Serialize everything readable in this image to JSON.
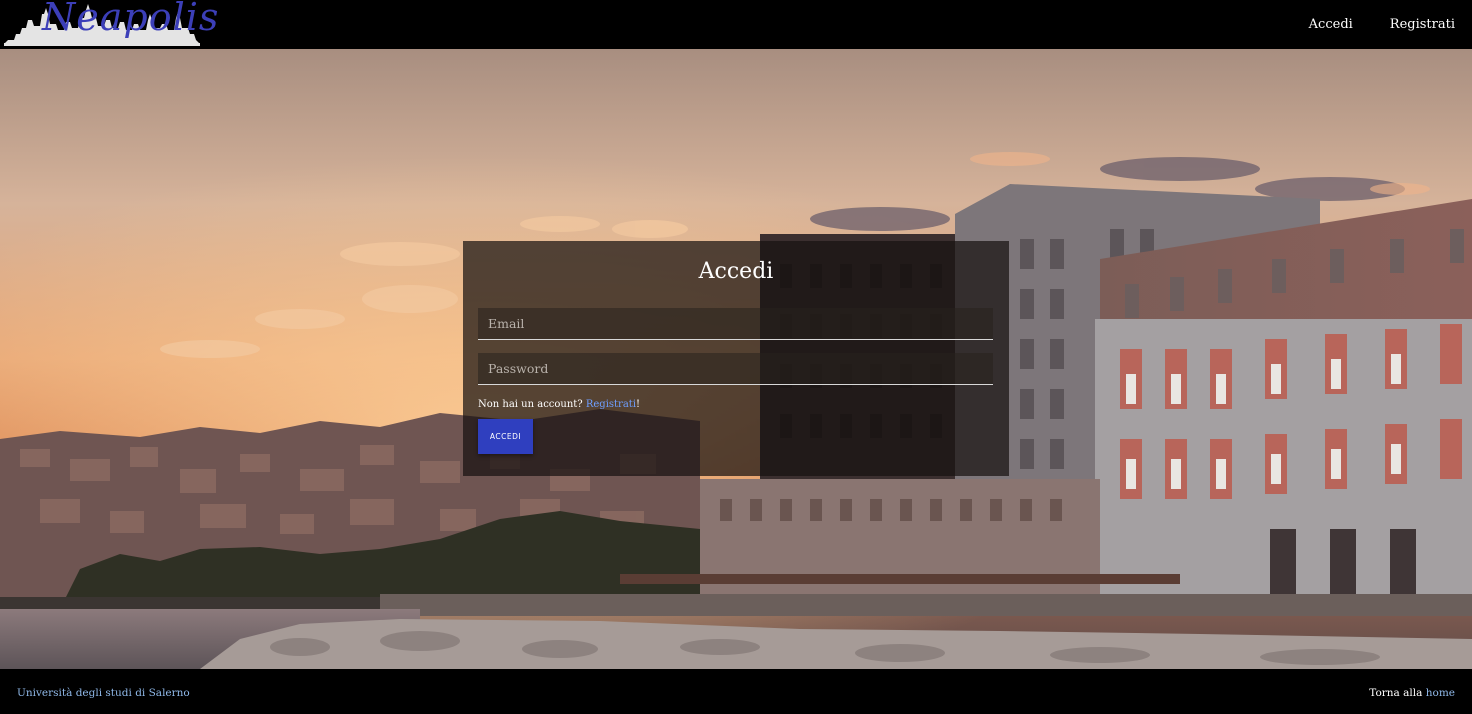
{
  "header": {
    "logo_text": "Neapolis",
    "nav": {
      "login_label": "Accedi",
      "register_label": "Registrati"
    }
  },
  "login": {
    "title": "Accedi",
    "email_placeholder": "Email",
    "password_placeholder": "Password",
    "signup_prompt": "Non hai un account? ",
    "signup_link": "Registrati",
    "signup_suffix": "!",
    "submit_label": "ACCEDI"
  },
  "footer": {
    "university": "Università degli studi di Salerno",
    "back_prefix": "Torna alla ",
    "home_link": "home"
  },
  "colors": {
    "accent_button": "#2f3fbf",
    "link": "#6e9eff",
    "logo": "#3c3fb8"
  }
}
